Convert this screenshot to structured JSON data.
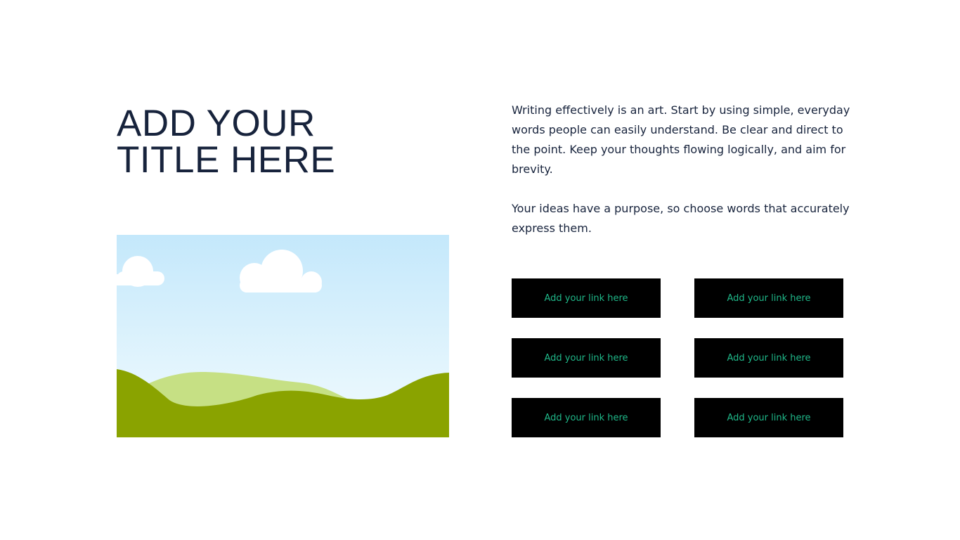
{
  "slide": {
    "title_line_1": "ADD YOUR",
    "title_line_2": "TITLE HERE",
    "paragraph_1": "Writing effectively is an art. Start by using simple, everyday words people can easily understand. Be clear and direct to the point. Keep your thoughts flowing logically, and aim for brevity.",
    "paragraph_2": "Your ideas have a purpose, so choose words that accurately express them."
  },
  "links": [
    {
      "label": "Add your link here"
    },
    {
      "label": "Add your link here"
    },
    {
      "label": "Add your link here"
    },
    {
      "label": "Add your link here"
    },
    {
      "label": "Add your link here"
    },
    {
      "label": "Add your link here"
    }
  ],
  "colors": {
    "title": "#17233c",
    "button_background": "#000000",
    "button_text": "#1fb889",
    "sky_top": "#c4e8fb",
    "sky_bottom": "#f2fbfe",
    "hill_light": "#c6e084",
    "hill_dark": "#8aa300",
    "cloud": "#ffffff"
  }
}
